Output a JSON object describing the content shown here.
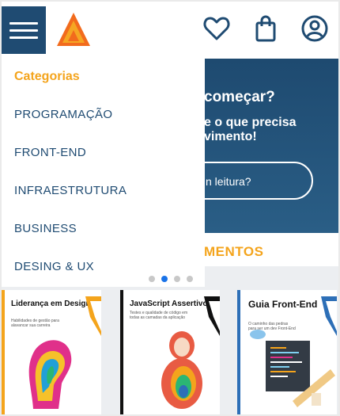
{
  "header": {
    "menu_icon": "hamburger-menu-icon",
    "logo": "orange-triangle-logo",
    "icons": [
      "heart-icon",
      "shopping-bag-icon",
      "user-circle-icon"
    ]
  },
  "banner": {
    "title": "começar?",
    "text": "e o que precisa vimento!",
    "cta": "n leitura?"
  },
  "section": {
    "title": "MENTOS"
  },
  "drawer": {
    "title": "Categorias",
    "items": [
      "PROGRAMAÇÃO",
      "FRONT-END",
      "INFRAESTRUTURA",
      "BUSINESS",
      "DESING & UX"
    ],
    "dots": {
      "count": 4,
      "active": 2
    }
  },
  "books": [
    {
      "title": "Liderança em Design",
      "subtitle": "Habilidades de gestão para alavancar sua carreira"
    },
    {
      "title": "JavaScript Assertivo",
      "subtitle": "Testes e qualidade de código em todas as camadas da aplicação"
    },
    {
      "title": "Guia Front-End",
      "subtitle": "O caminho das pedras para ser um dev Front-End"
    }
  ],
  "colors": {
    "brand_blue": "#1f4b72",
    "accent_orange": "#f4a41c",
    "dot_active": "#1a73e8"
  }
}
